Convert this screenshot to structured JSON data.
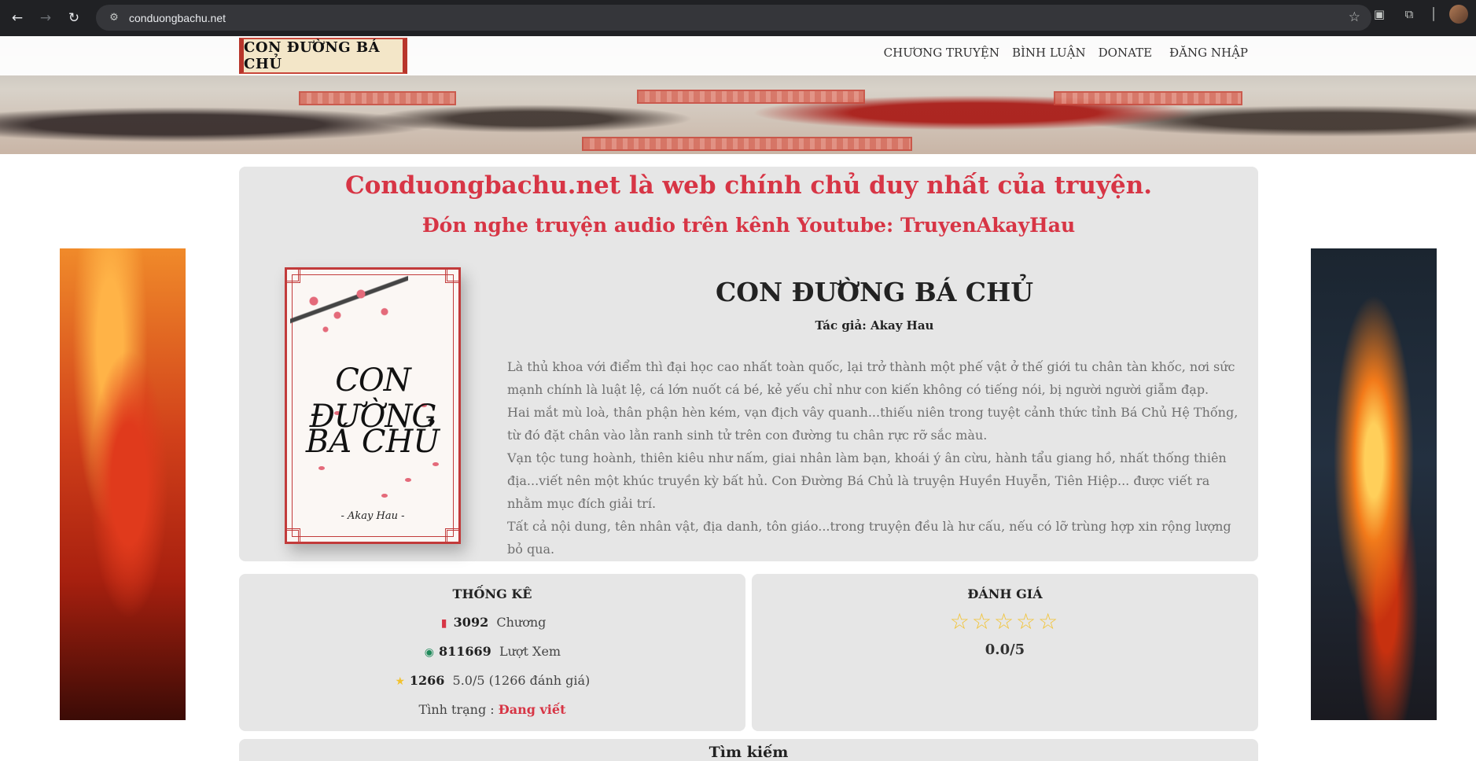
{
  "browser": {
    "url": "conduongbachu.net",
    "back_icon": "←",
    "forward_icon": "→",
    "reload_icon": "↻",
    "site_info_icon": "⚙",
    "star_icon": "☆",
    "ext1_icon": "▣",
    "ext2_icon": "⧉",
    "divider": "│"
  },
  "header": {
    "logo_text": "CON ĐƯỜNG BÁ CHỦ",
    "nav": [
      "CHƯƠNG TRUYỆN",
      "BÌNH LUẬN",
      "DONATE",
      "ĐĂNG NHẬP"
    ]
  },
  "notice": {
    "line1": "Conduongbachu.net là web chính chủ duy nhất của truyện.",
    "line2": "Đón nghe truyện audio trên kênh Youtube: TruyenAkayHau"
  },
  "cover": {
    "title_line1": "CON ĐƯỜNG",
    "title_line2": "BÁ CHỦ",
    "author": "- Akay Hau -"
  },
  "book": {
    "title": "CON ĐƯỜNG BÁ CHỦ",
    "author_line": "Tác giả: Akay Hau",
    "description": [
      "Là thủ khoa với điểm thì đại học cao nhất toàn quốc, lại trở thành một phế vật ở thế giới tu chân tàn khốc, nơi sức mạnh chính là luật lệ, cá lớn nuốt cá bé, kẻ yếu chỉ như con kiến không có tiếng nói, bị người người giẫm đạp.",
      "Hai mắt mù loà, thân phận hèn kém, vạn địch vây quanh...thiếu niên trong tuyệt cảnh thức tỉnh Bá Chủ Hệ Thống, từ đó đặt chân vào lằn ranh sinh tử trên con đường tu chân rực rỡ sắc màu.",
      "Vạn tộc tung hoành, thiên kiêu như nấm, giai nhân làm bạn, khoái ý ân cừu, hành tẩu giang hồ, nhất thống thiên địa...viết nên một khúc truyền kỳ bất hủ. Con Đường Bá Chủ là truyện Huyền Huyễn, Tiên Hiệp... được viết ra nhằm mục đích giải trí.",
      "Tất cả nội dung, tên nhân vật, địa danh, tôn giáo...trong truyện đều là hư cấu, nếu có lỡ trùng hợp xin rộng lượng bỏ qua."
    ]
  },
  "stats": {
    "heading": "THỐNG KÊ",
    "chapters_value": "3092",
    "chapters_label": "Chương",
    "views_value": "811669",
    "views_label": "Lượt Xem",
    "rating_count": "1266",
    "rating_text": "5.0/5 (1266 đánh giá)",
    "status_label": "Tình trạng :",
    "status_value": "Đang viết",
    "bookmark_icon": "▮",
    "eye_icon": "◉",
    "star_icon": "★"
  },
  "rating": {
    "heading": "ĐÁNH GIÁ",
    "stars": "☆☆☆☆☆",
    "value": "0.0/5"
  },
  "search": {
    "heading": "Tìm kiếm"
  }
}
